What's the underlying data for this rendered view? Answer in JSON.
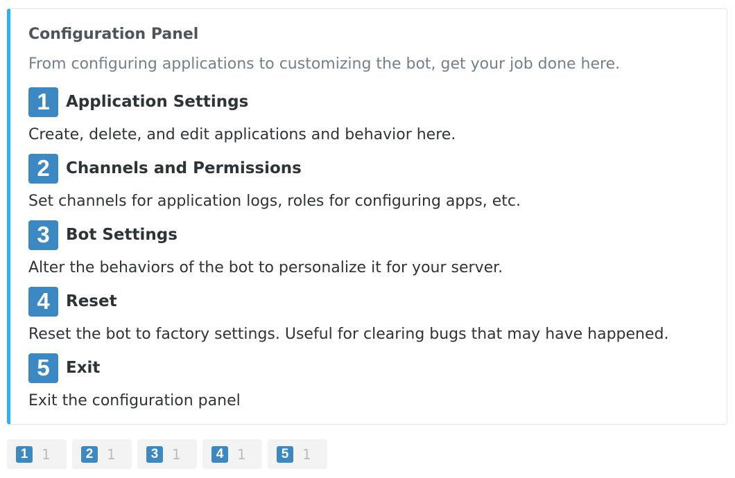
{
  "embed": {
    "title": "Configuration Panel",
    "description": "From configuring applications to customizing the bot, get your job done here.",
    "accent_color": "#2bb1f4",
    "fields": [
      {
        "icon": "keycap-1",
        "number": "1",
        "name": "Application Settings",
        "value": "Create, delete, and edit applications and behavior here."
      },
      {
        "icon": "keycap-2",
        "number": "2",
        "name": "Channels and Permissions",
        "value": "Set channels for application logs, roles for configuring apps, etc."
      },
      {
        "icon": "keycap-3",
        "number": "3",
        "name": "Bot Settings",
        "value": "Alter the behaviors of the bot to personalize it for your server."
      },
      {
        "icon": "keycap-4",
        "number": "4",
        "name": "Reset",
        "value": "Reset the bot to factory settings. Useful for clearing bugs that may have happened."
      },
      {
        "icon": "keycap-5",
        "number": "5",
        "name": "Exit",
        "value": "Exit the configuration panel"
      }
    ]
  },
  "reactions": [
    {
      "icon": "keycap-1",
      "emoji": "1",
      "count": "1"
    },
    {
      "icon": "keycap-2",
      "emoji": "2",
      "count": "1"
    },
    {
      "icon": "keycap-3",
      "emoji": "3",
      "count": "1"
    },
    {
      "icon": "keycap-4",
      "emoji": "4",
      "count": "1"
    },
    {
      "icon": "keycap-5",
      "emoji": "5",
      "count": "1"
    }
  ],
  "keycap_color": "#3b88c3"
}
